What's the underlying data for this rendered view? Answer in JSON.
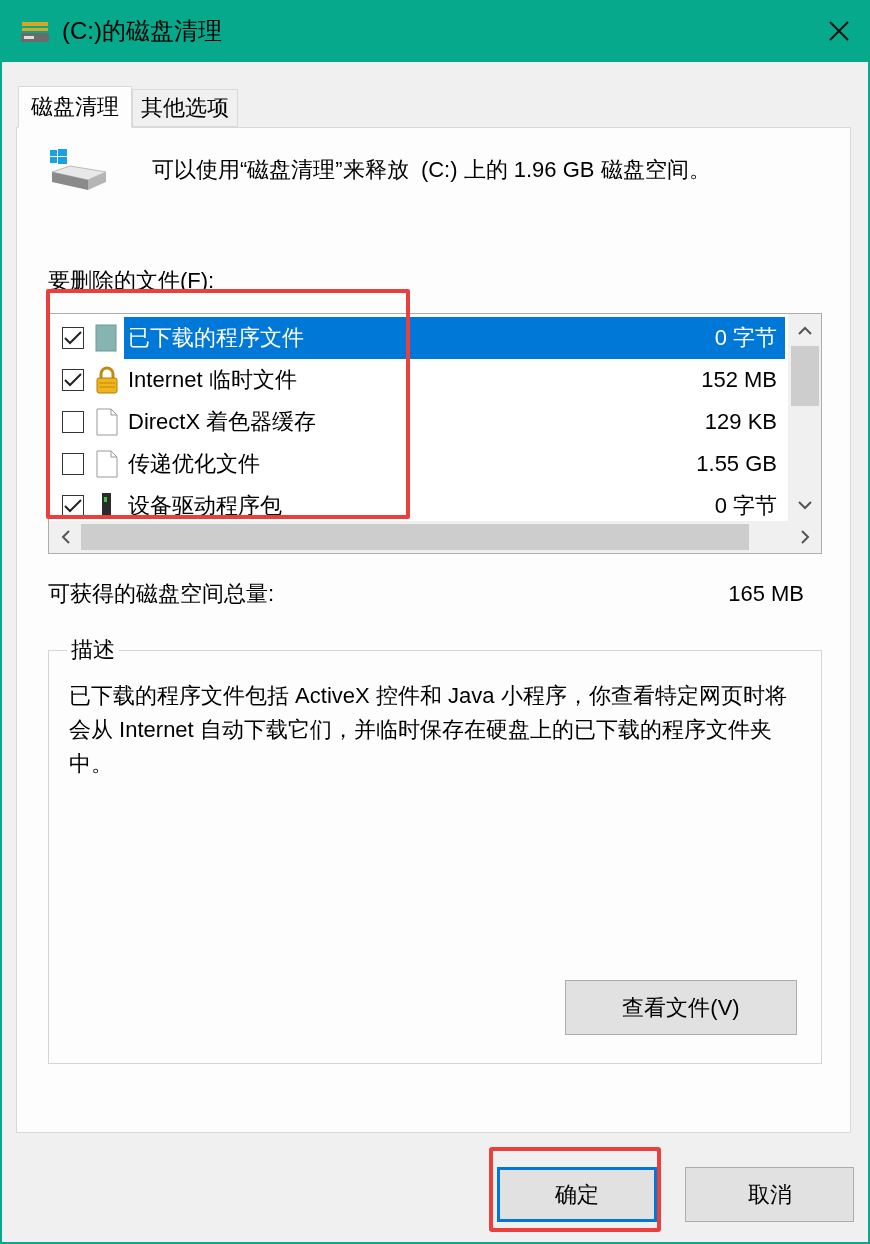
{
  "window": {
    "title": "(C:)的磁盘清理"
  },
  "tabs": [
    {
      "label": "磁盘清理",
      "selected": true
    },
    {
      "label": "其他选项",
      "selected": false
    }
  ],
  "intro": "可以使用“磁盘清理”来释放  (C:) 上的 1.96 GB 磁盘空间。",
  "files_label": "要删除的文件(F):",
  "file_list": {
    "highlighted": true,
    "rows": [
      {
        "name": "已下载的程序文件",
        "size": "0 字节",
        "checked": true,
        "selected": true,
        "kind": "program"
      },
      {
        "name": "Internet 临时文件",
        "size": "152 MB",
        "checked": true,
        "selected": false,
        "kind": "lock"
      },
      {
        "name": "DirectX 着色器缓存",
        "size": "129 KB",
        "checked": false,
        "selected": false,
        "kind": "file"
      },
      {
        "name": "传递优化文件",
        "size": "1.55 GB",
        "checked": false,
        "selected": false,
        "kind": "file"
      },
      {
        "name": "设备驱动程序包",
        "size": "0 字节",
        "checked": true,
        "selected": false,
        "kind": "driver"
      }
    ]
  },
  "total": {
    "label": "可获得的磁盘空间总量:",
    "value": "165 MB"
  },
  "description": {
    "title": "描述",
    "text": "已下载的程序文件包括 ActiveX 控件和 Java 小程序，你查看特定网页时将会从 Internet 自动下载它们，并临时保存在硬盘上的已下载的程序文件夹中。",
    "button": "查看文件(V)"
  },
  "buttons": [
    {
      "label": "确定",
      "default": true,
      "highlighted": true
    },
    {
      "label": "取消",
      "default": false,
      "highlighted": false
    }
  ]
}
